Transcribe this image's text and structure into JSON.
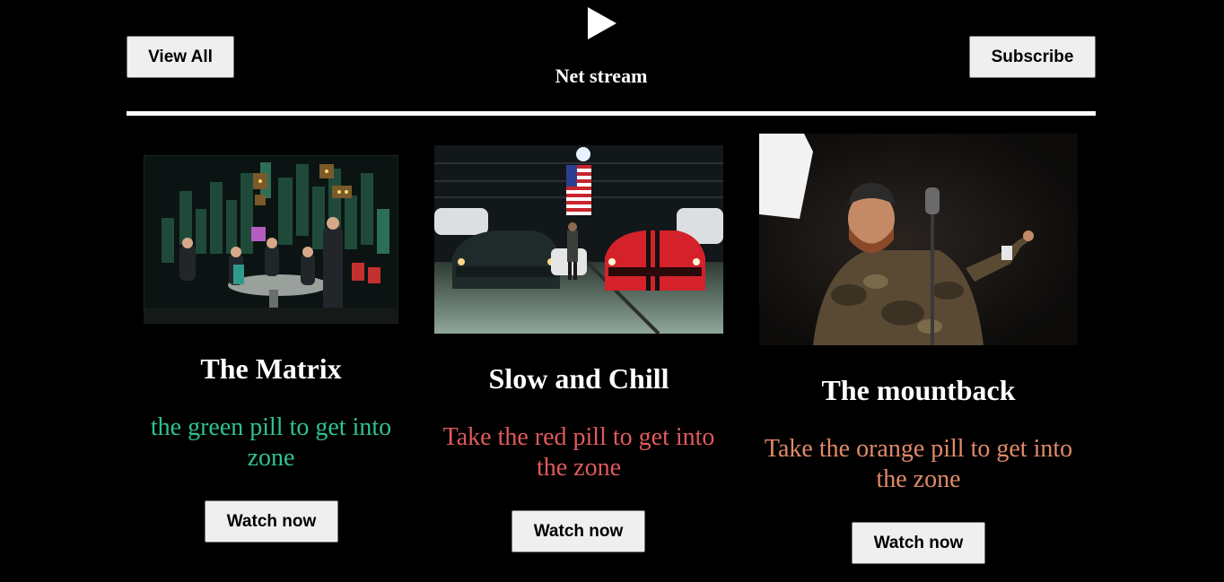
{
  "header": {
    "view_all_label": "View All",
    "subscribe_label": "Subscribe",
    "brand": "Net stream",
    "play_icon": "play-icon"
  },
  "colors": {
    "background": "#000000",
    "green_tagline": "#2fc291",
    "red_tagline": "#e05a5a",
    "orange_tagline": "#e08a6a"
  },
  "movies": [
    {
      "title": "The Matrix",
      "tagline": "the green pill to get into zone",
      "button_label": "Watch now"
    },
    {
      "title": "Slow and Chill",
      "tagline": "Take the red pill to get into the zone",
      "button_label": "Watch now"
    },
    {
      "title": "The mountback",
      "tagline": "Take the orange pill to get into the zone",
      "button_label": "Watch now"
    }
  ]
}
